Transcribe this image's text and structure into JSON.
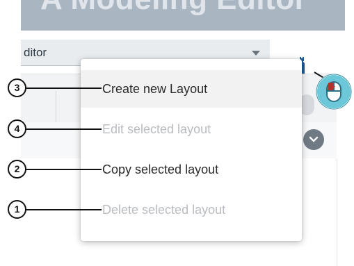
{
  "banner": {
    "title": "A Modeling Editor"
  },
  "toolbar": {
    "editor_select_value": "ditor",
    "settings_icon": "wrench-window-icon"
  },
  "menu": {
    "items": [
      {
        "label": "Create new Layout",
        "enabled": true
      },
      {
        "label": "Edit selected layout",
        "enabled": false
      },
      {
        "label": "Copy selected layout",
        "enabled": true
      },
      {
        "label": "Delete selected layout",
        "enabled": false
      }
    ]
  },
  "callouts": [
    "3",
    "4",
    "2",
    "1"
  ],
  "colors": {
    "banner": "#a9b6c2",
    "settings_icon": "#1d5c9a",
    "mouse_badge": "#6cc7d9",
    "disabled_text": "#b9bcc0"
  }
}
